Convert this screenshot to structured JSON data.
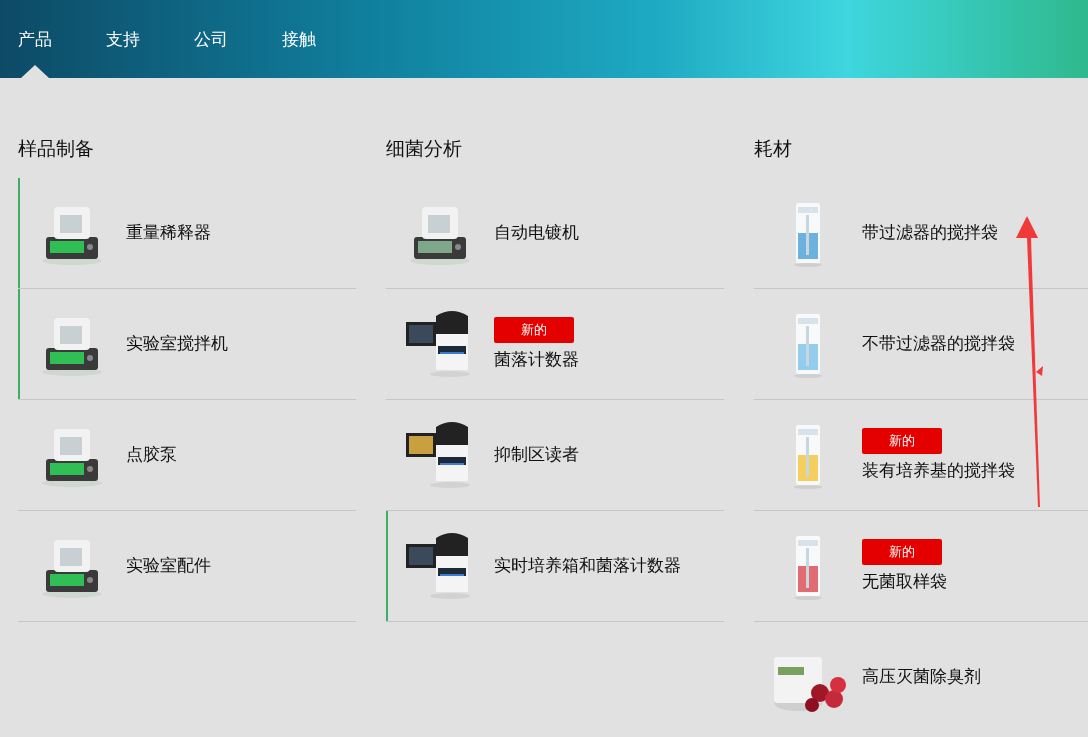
{
  "nav": [
    {
      "label": "产品",
      "selected": true
    },
    {
      "label": "支持",
      "selected": false
    },
    {
      "label": "公司",
      "selected": false
    },
    {
      "label": "接触",
      "selected": false
    }
  ],
  "columns": [
    {
      "heading": "样品制备",
      "items": [
        {
          "label": "重量稀释器",
          "highlighted": true
        },
        {
          "label": "实验室搅拌机",
          "highlighted": true
        },
        {
          "label": "点胶泵",
          "highlighted": false
        },
        {
          "label": "实验室配件",
          "highlighted": false
        }
      ]
    },
    {
      "heading": "细菌分析",
      "items": [
        {
          "label": "自动电镀机",
          "highlighted": false
        },
        {
          "label": "菌落计数器",
          "badge": "新的",
          "highlighted": false
        },
        {
          "label": "抑制区读者",
          "highlighted": false
        },
        {
          "label": "实时培养箱和菌落计数器",
          "highlighted": true
        }
      ]
    },
    {
      "heading": "耗材",
      "items": [
        {
          "label": "带过滤器的搅拌袋",
          "highlighted": false
        },
        {
          "label": "不带过滤器的搅拌袋",
          "highlighted": false
        },
        {
          "label": "装有培养基的搅拌袋",
          "badge": "新的",
          "highlighted": false
        },
        {
          "label": "无菌取样袋",
          "badge": "新的",
          "highlighted": false
        },
        {
          "label": "高压灭菌除臭剂",
          "highlighted": false
        }
      ]
    }
  ],
  "annotations": [
    {
      "kind": "arrow"
    }
  ]
}
